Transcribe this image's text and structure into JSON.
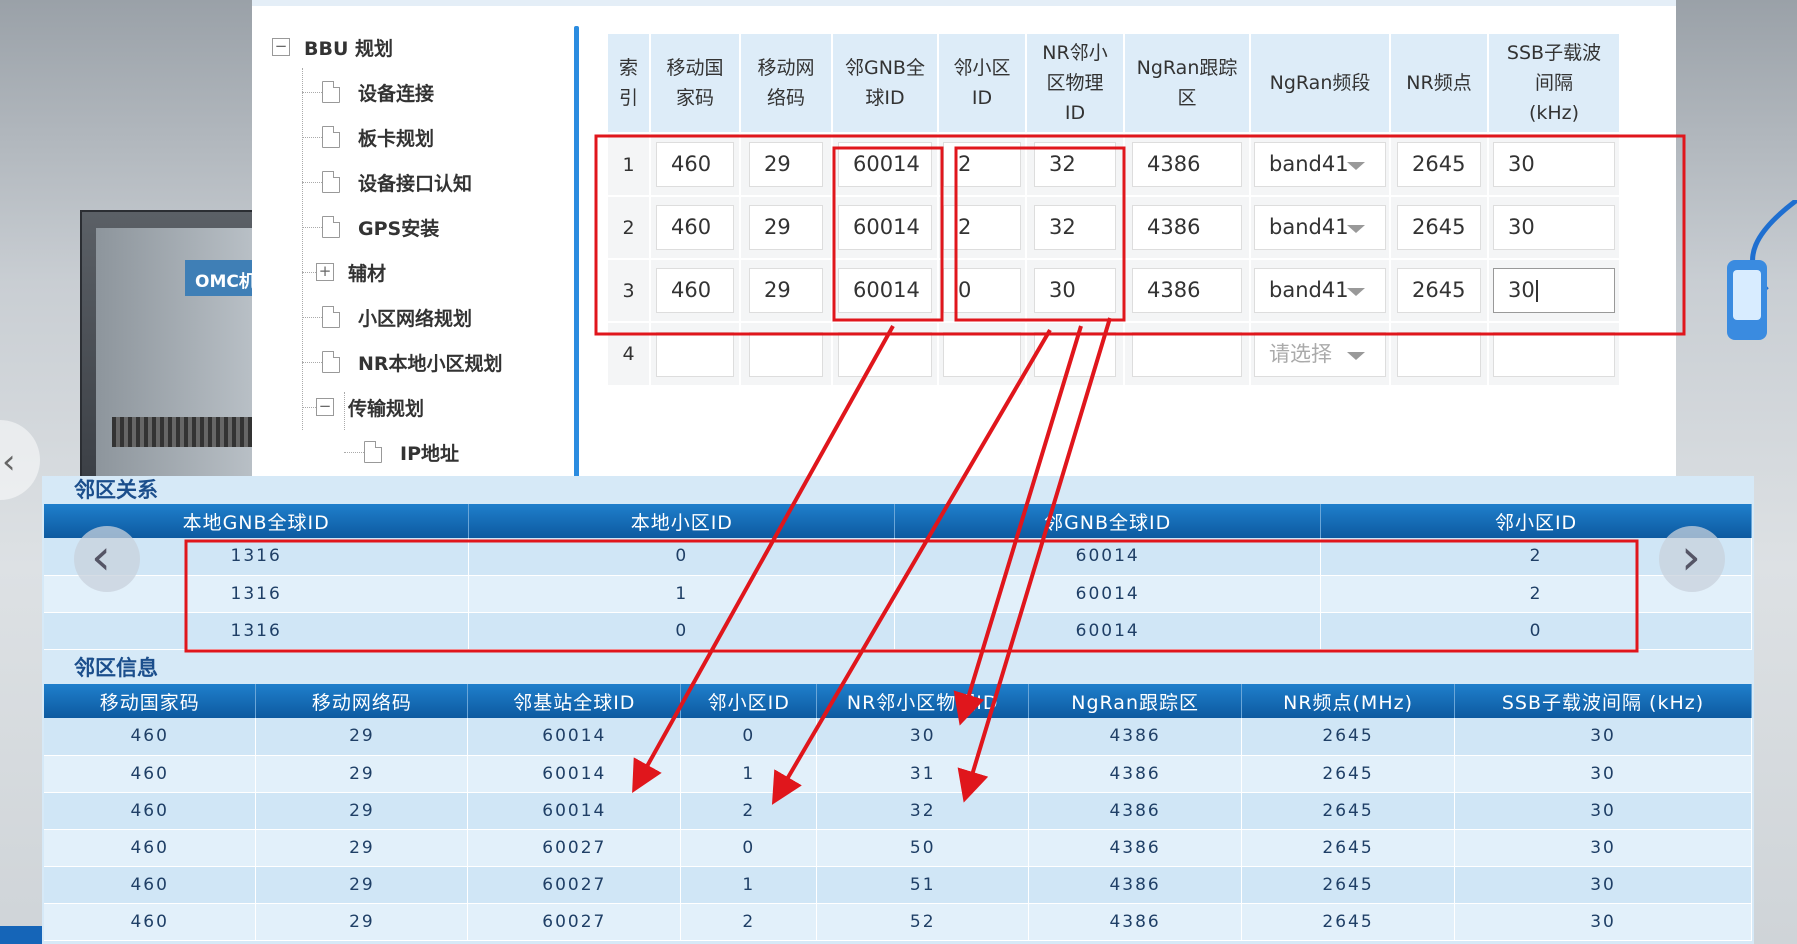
{
  "background": {
    "cabinet_label": "OMC机",
    "accent": "#2b8ce0",
    "annotation_color": "#e0161c"
  },
  "tree": {
    "items": [
      {
        "label": "BBU 规划",
        "type": "folder-open"
      },
      {
        "label": "设备连接",
        "type": "doc"
      },
      {
        "label": "板卡规划",
        "type": "doc"
      },
      {
        "label": "设备接口认知",
        "type": "doc"
      },
      {
        "label": "GPS安装",
        "type": "doc"
      },
      {
        "label": "辅材",
        "type": "folder-closed"
      },
      {
        "label": "小区网络规划",
        "type": "doc"
      },
      {
        "label": "NR本地小区规划",
        "type": "doc"
      },
      {
        "label": "传输规划",
        "type": "folder-open"
      },
      {
        "label": "IP地址",
        "type": "doc"
      }
    ],
    "toggle_open": "−",
    "toggle_closed": "+"
  },
  "config_table": {
    "headers": [
      "索\n引",
      "移动国\n家码",
      "移动网\n络码",
      "邻GNB全\n球ID",
      "邻小区\nID",
      "NR邻小\n区物理\nID",
      "NgRan跟踪\n区",
      "NgRan频段",
      "NR频点",
      "SSB子载波\n间隔\n(kHz)"
    ],
    "rows": [
      {
        "index": "1",
        "mcc": "460",
        "mnc": "29",
        "gnb": "60014",
        "cell": "2",
        "pci": "32",
        "tac": "4386",
        "band": "band41",
        "freq": "2645",
        "ssb": "30"
      },
      {
        "index": "2",
        "mcc": "460",
        "mnc": "29",
        "gnb": "60014",
        "cell": "2",
        "pci": "32",
        "tac": "4386",
        "band": "band41",
        "freq": "2645",
        "ssb": "30"
      },
      {
        "index": "3",
        "mcc": "460",
        "mnc": "29",
        "gnb": "60014",
        "cell": "0",
        "pci": "30",
        "tac": "4386",
        "band": "band41",
        "freq": "2645",
        "ssb": "30"
      },
      {
        "index": "4",
        "mcc": "",
        "mnc": "",
        "gnb": "",
        "cell": "",
        "pci": "",
        "tac": "",
        "band": "请选择",
        "freq": "",
        "ssb": ""
      }
    ]
  },
  "neighbor_relation": {
    "title": "邻区关系",
    "headers": [
      "本地GNB全球ID",
      "本地小区ID",
      "邻GNB全球ID",
      "邻小区ID"
    ],
    "rows": [
      [
        "1316",
        "0",
        "60014",
        "2"
      ],
      [
        "1316",
        "1",
        "60014",
        "2"
      ],
      [
        "1316",
        "0",
        "60014",
        "0"
      ]
    ]
  },
  "neighbor_info": {
    "title": "邻区信息",
    "headers": [
      "移动国家码",
      "移动网络码",
      "邻基站全球ID",
      "邻小区ID",
      "NR邻小区物理ID",
      "NgRan跟踪区",
      "NR频点(MHz)",
      "SSB子载波间隔 (kHz)"
    ],
    "rows": [
      [
        "460",
        "29",
        "60014",
        "0",
        "30",
        "4386",
        "2645",
        "30"
      ],
      [
        "460",
        "29",
        "60014",
        "1",
        "31",
        "4386",
        "2645",
        "30"
      ],
      [
        "460",
        "29",
        "60014",
        "2",
        "32",
        "4386",
        "2645",
        "30"
      ],
      [
        "460",
        "29",
        "60027",
        "0",
        "50",
        "4386",
        "2645",
        "30"
      ],
      [
        "460",
        "29",
        "60027",
        "1",
        "51",
        "4386",
        "2645",
        "30"
      ],
      [
        "460",
        "29",
        "60027",
        "2",
        "52",
        "4386",
        "2645",
        "30"
      ]
    ]
  },
  "nav": {
    "prev_icon": "chevron-left-icon",
    "next_icon": "chevron-right-icon"
  }
}
